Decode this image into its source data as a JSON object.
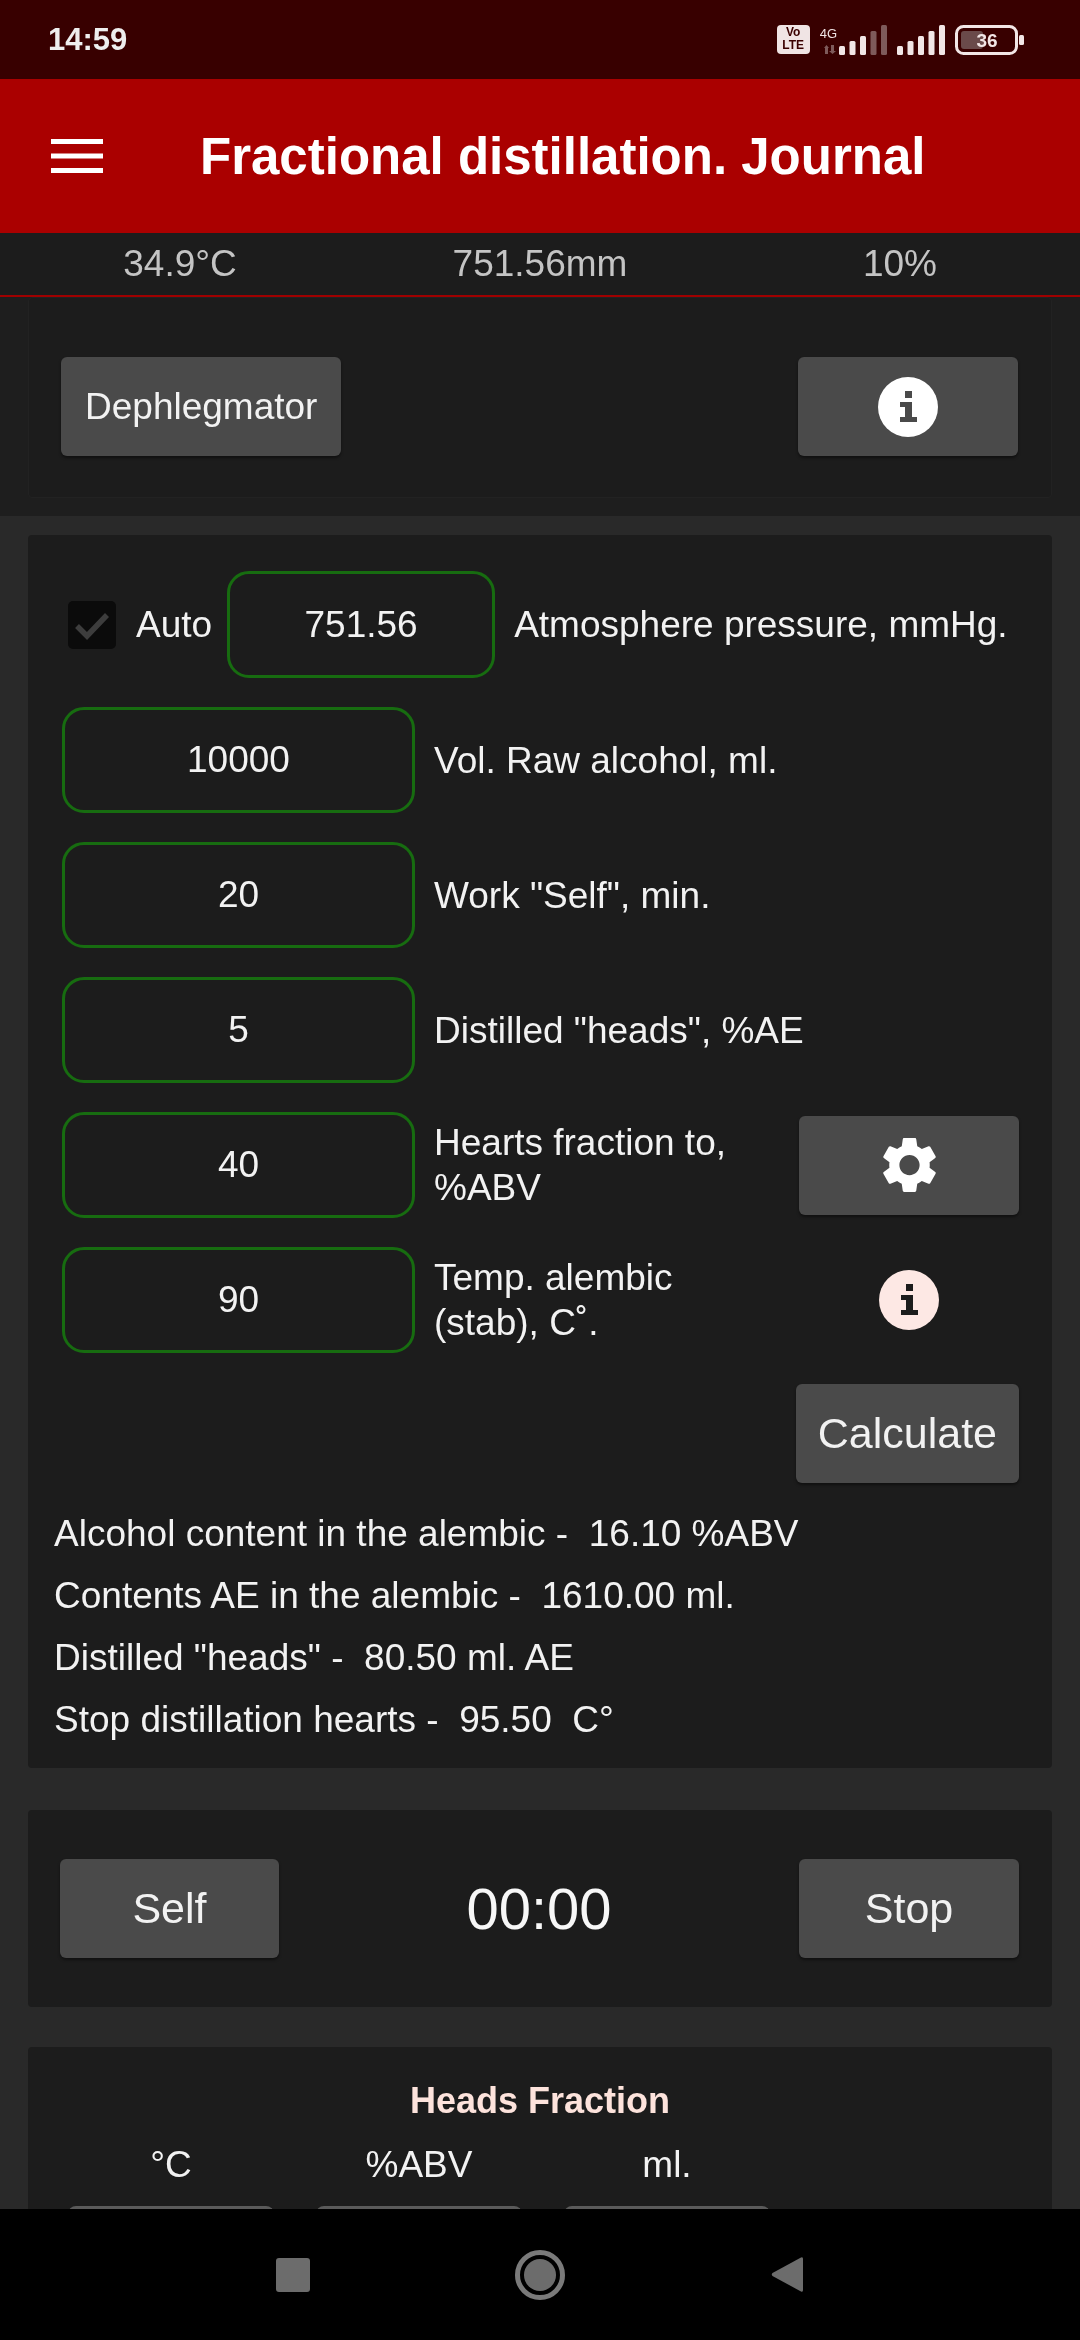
{
  "status_bar": {
    "time": "14:59",
    "volte": "Vo LTE",
    "network": "4G",
    "battery": "36"
  },
  "app_bar": {
    "title": "Fractional distillation. Journal"
  },
  "readings": [
    "34.9°C",
    "751.56mm",
    "10%"
  ],
  "top_card": {
    "buttons": [
      {
        "kind": "text",
        "label": "Dephlegmator"
      },
      {
        "kind": "info"
      }
    ]
  },
  "settings_card": {
    "pressure_row": {
      "auto": {
        "label": "Auto",
        "checked": true
      },
      "value": "751.56",
      "label": "Atmosphere pressure, mmHg."
    },
    "rows": [
      {
        "kind": "plain",
        "value": "10000",
        "label": "Vol. Raw alcohol, ml."
      },
      {
        "kind": "plain",
        "value": "20",
        "label": "Work \"Self\", min."
      },
      {
        "kind": "plain",
        "value": "5",
        "label": "Distilled \"heads\", %AE"
      },
      {
        "kind": "settings",
        "value": "40",
        "label": "Hearts fraction to, %ABV"
      },
      {
        "kind": "info",
        "value": "90",
        "label": "Temp. alembic (stab), C˚."
      }
    ],
    "calculate_button": "Calculate",
    "results": [
      "Alcohol content in the alembic -  16.10 %ABV",
      "Contents AE in the alembic -  1610.00 ml.",
      "Distilled \"heads\" -  80.50 ml. AE",
      "Stop distillation hearts -  95.50  C°"
    ]
  },
  "timer_card": {
    "start_button": "Self",
    "time": "00:00",
    "stop_button": "Stop"
  },
  "heads_card": {
    "title": "Heads Fraction",
    "columns": [
      {
        "header": "°C"
      },
      {
        "header": "%ABV"
      },
      {
        "header": "ml."
      }
    ]
  }
}
